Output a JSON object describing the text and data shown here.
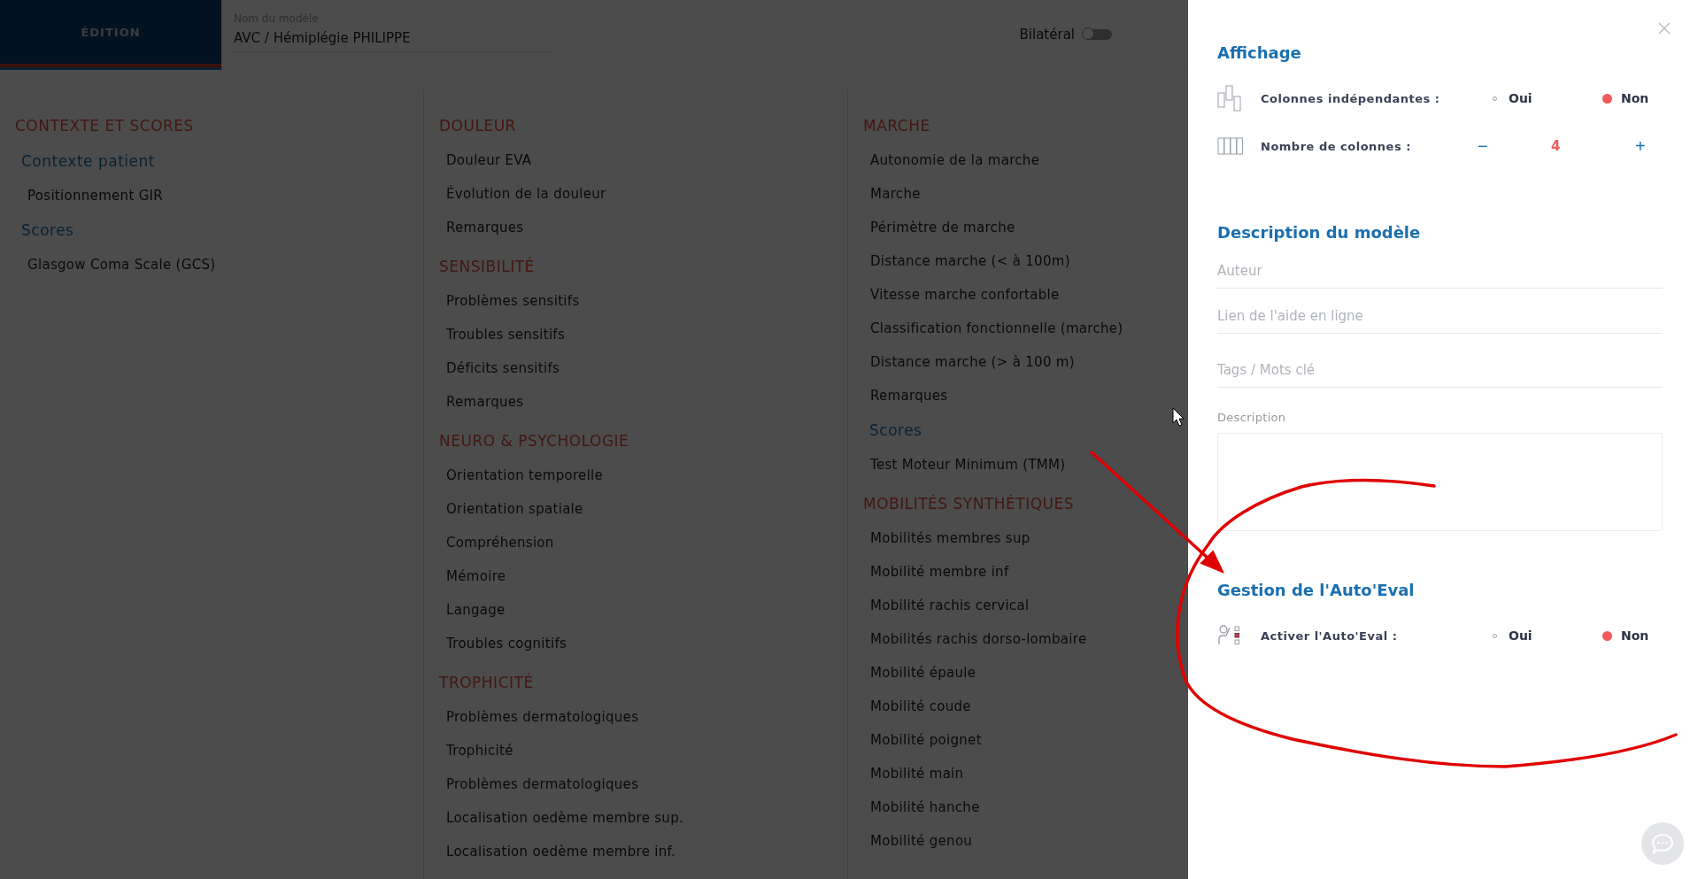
{
  "header": {
    "tab": "ÉDITION",
    "model_label": "Nom du modèle",
    "model_name": "AVC / Hémiplégie PHILIPPE",
    "bilateral": {
      "label": "Bilatéral",
      "on": false
    }
  },
  "columns": [
    [
      {
        "kind": "category",
        "label": "CONTEXTE ET SCORES"
      },
      {
        "kind": "group",
        "label": "Contexte patient"
      },
      {
        "kind": "field",
        "label": "Positionnement GIR"
      },
      {
        "kind": "group",
        "label": "Scores"
      },
      {
        "kind": "field",
        "label": "Glasgow Coma Scale (GCS)"
      }
    ],
    [
      {
        "kind": "category",
        "label": "DOULEUR"
      },
      {
        "kind": "field",
        "label": "Douleur EVA"
      },
      {
        "kind": "field",
        "label": "Évolution de la douleur"
      },
      {
        "kind": "field",
        "label": "Remarques"
      },
      {
        "kind": "category",
        "label": "SENSIBILITÉ"
      },
      {
        "kind": "field",
        "label": "Problèmes sensitifs"
      },
      {
        "kind": "field",
        "label": "Troubles sensitifs"
      },
      {
        "kind": "field",
        "label": "Déficits sensitifs"
      },
      {
        "kind": "field",
        "label": "Remarques"
      },
      {
        "kind": "category",
        "label": "NEURO & PSYCHOLOGIE"
      },
      {
        "kind": "field",
        "label": "Orientation temporelle"
      },
      {
        "kind": "field",
        "label": "Orientation spatiale"
      },
      {
        "kind": "field",
        "label": "Compréhension"
      },
      {
        "kind": "field",
        "label": "Mémoire"
      },
      {
        "kind": "field",
        "label": "Langage"
      },
      {
        "kind": "field",
        "label": "Troubles cognitifs"
      },
      {
        "kind": "category",
        "label": "TROPHICITÉ"
      },
      {
        "kind": "field",
        "label": "Problèmes dermatologiques"
      },
      {
        "kind": "field",
        "label": "Trophicité"
      },
      {
        "kind": "field",
        "label": "Problèmes dermatologiques"
      },
      {
        "kind": "field",
        "label": "Localisation oedème membre sup."
      },
      {
        "kind": "field",
        "label": "Localisation oedème membre inf."
      }
    ],
    [
      {
        "kind": "category",
        "label": "MARCHE"
      },
      {
        "kind": "field",
        "label": "Autonomie de la marche"
      },
      {
        "kind": "field",
        "label": "Marche"
      },
      {
        "kind": "field",
        "label": "Périmètre de marche"
      },
      {
        "kind": "field",
        "label": "Distance marche (< à 100m)"
      },
      {
        "kind": "field",
        "label": "Vitesse marche confortable"
      },
      {
        "kind": "field",
        "label": "Classification fonctionnelle (marche)"
      },
      {
        "kind": "field",
        "label": "Distance marche (> à 100 m)"
      },
      {
        "kind": "field",
        "label": "Remarques"
      },
      {
        "kind": "group",
        "label": "Scores"
      },
      {
        "kind": "field",
        "label": "Test Moteur Minimum (TMM)"
      },
      {
        "kind": "category",
        "label": "MOBILITÉS SYNTHÉTIQUES"
      },
      {
        "kind": "field",
        "label": "Mobilités membres sup"
      },
      {
        "kind": "field",
        "label": "Mobilité membre inf"
      },
      {
        "kind": "field",
        "label": "Mobilité rachis cervical"
      },
      {
        "kind": "field",
        "label": "Mobilités rachis dorso-lombaire"
      },
      {
        "kind": "field",
        "label": "Mobilité épaule"
      },
      {
        "kind": "field",
        "label": "Mobilité coude"
      },
      {
        "kind": "field",
        "label": "Mobilité poignet"
      },
      {
        "kind": "field",
        "label": "Mobilité main"
      },
      {
        "kind": "field",
        "label": "Mobilité hanche"
      },
      {
        "kind": "field",
        "label": "Mobilité genou"
      }
    ]
  ],
  "panel": {
    "display": {
      "title": "Affichage",
      "rows": [
        {
          "kind": "choice",
          "label": "Colonnes indépendantes :",
          "options": [
            {
              "label": "Oui",
              "selected": false
            },
            {
              "label": "Non",
              "selected": true
            }
          ]
        },
        {
          "kind": "stepper",
          "label": "Nombre de colonnes :",
          "minus": "−",
          "value": "4",
          "plus": "+"
        }
      ]
    },
    "description": {
      "title": "Description du modèle",
      "fields": [
        {
          "placeholder": "Auteur"
        },
        {
          "placeholder": "Lien de l'aide en ligne"
        },
        {
          "placeholder": "Tags / Mots clé"
        }
      ],
      "textarea_label": "Description"
    },
    "auto_eval": {
      "title": "Gestion de l'Auto'Eval",
      "rows": [
        {
          "kind": "choice",
          "label": "Activer l'Auto'Eval :",
          "options": [
            {
              "label": "Oui",
              "selected": false
            },
            {
              "label": "Non",
              "selected": true
            }
          ]
        }
      ]
    }
  }
}
